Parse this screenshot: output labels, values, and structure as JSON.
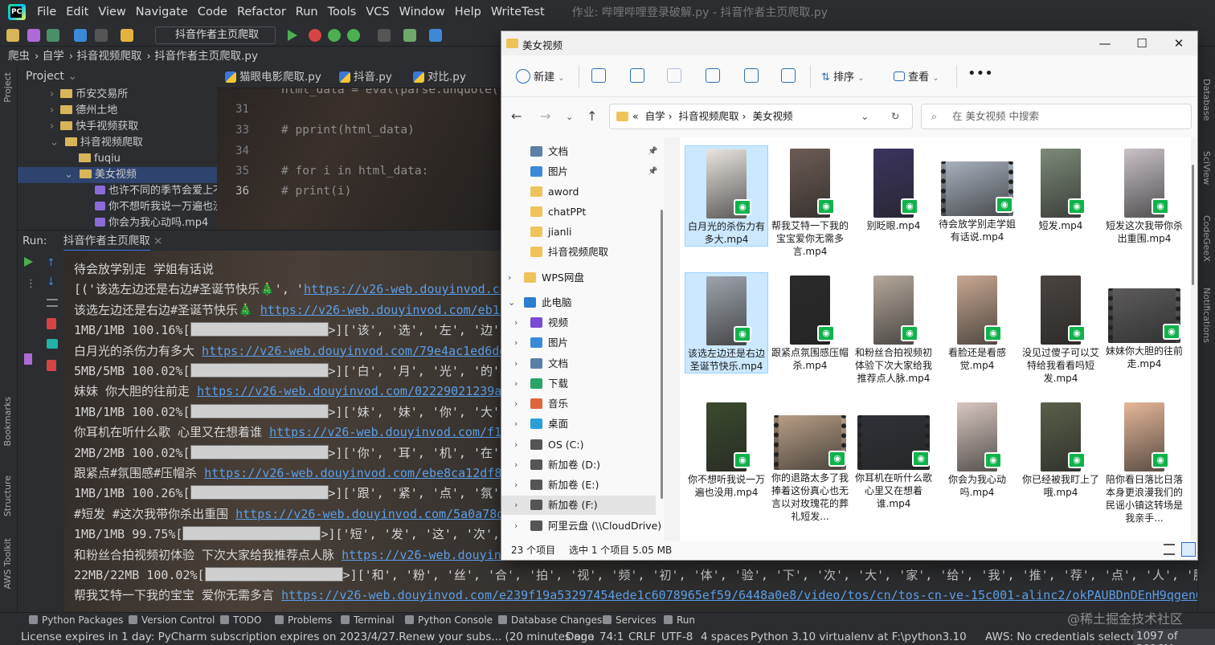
{
  "menu": {
    "items": [
      "File",
      "Edit",
      "View",
      "Navigate",
      "Code",
      "Refactor",
      "Run",
      "Tools",
      "VCS",
      "Window",
      "Help",
      "WriteTest"
    ],
    "title": "作业: 哔哩哔哩登录破解.py - 抖音作者主页爬取.py"
  },
  "toolbar": {
    "run_config": "抖音作者主页爬取"
  },
  "breadcrumb": [
    "爬虫",
    "自学",
    "抖音视频爬取",
    "抖音作者主页爬取.py"
  ],
  "project": {
    "header": "Project",
    "items": [
      {
        "label": "币安交易所",
        "type": "folder",
        "depth": 1
      },
      {
        "label": "德州土地",
        "type": "folder",
        "depth": 1
      },
      {
        "label": "快手视频获取",
        "type": "folder",
        "depth": 1
      },
      {
        "label": "抖音视频爬取",
        "type": "folder",
        "depth": 1
      },
      {
        "label": "fuqiu",
        "type": "folder",
        "depth": 2
      },
      {
        "label": "美女视频",
        "type": "folder",
        "depth": 2
      },
      {
        "label": "也许不同的季节会爱上不",
        "type": "video",
        "depth": 3
      },
      {
        "label": "你不想听我说一万遍也没",
        "type": "video",
        "depth": 3
      },
      {
        "label": "你会为我心动吗.mp4",
        "type": "video",
        "depth": 3
      }
    ]
  },
  "editor_tabs": [
    "猫眼电影爬取.py",
    "抖音.py",
    "对比.py"
  ],
  "editor": {
    "lines": [
      {
        "num": "31",
        "text": "html_data = eval(parse.unquote("
      },
      {
        "num": "32",
        "text": ""
      },
      {
        "num": "33",
        "text": "# pprint(html_data)"
      },
      {
        "num": "34",
        "text": ""
      },
      {
        "num": "35",
        "text": "# for i in html_data:"
      },
      {
        "num": "36",
        "text": "#     print(i)"
      }
    ]
  },
  "run": {
    "label": "Run:",
    "tab": "抖音作者主页爬取"
  },
  "console": [
    {
      "text": "待会放学别走 学姐有话说",
      "url": "",
      "rest": ""
    },
    {
      "text": "[('该选左边还是右边#圣诞节快乐🎄', '",
      "url": "https://v26-web.douyinvod.com/",
      "rest": ""
    },
    {
      "text": "该选左边还是右边#圣诞节快乐🎄 ",
      "url": "https://v26-web.douyinvod.com/eb131c",
      "rest": ""
    },
    {
      "text": "1MB/1MB 100.16%[",
      "bar": true,
      "rest": ">]['该', '选', '左', '边',"
    },
    {
      "text": "白月光的杀伤力有多大 ",
      "url": "https://v26-web.douyinvod.com/79e4ac1ed6ddc7",
      "rest": ""
    },
    {
      "text": "5MB/5MB 100.02%[",
      "bar": true,
      "rest": ">]['白', '月', '光', '的',"
    },
    {
      "text": "妹妹 你大胆的往前走 ",
      "url": "https://v26-web.douyinvod.com/02229021239a1f4",
      "rest": ""
    },
    {
      "text": "1MB/1MB 100.02%[",
      "bar": true,
      "rest": ">]['妹', '妹', '你', '大',"
    },
    {
      "text": "你耳机在听什么歌 心里又在想着谁 ",
      "url": "https://v26-web.douyinvod.com/f11f7",
      "rest": ""
    },
    {
      "text": "2MB/2MB 100.02%[",
      "bar": true,
      "rest": ">]['你', '耳', '机', '在',"
    },
    {
      "text": "跟紧点#氛围感#压帽杀 ",
      "url": "https://v26-web.douyinvod.com/ebe8ca12df858e",
      "rest": ""
    },
    {
      "text": "1MB/1MB 100.26%[",
      "bar": true,
      "rest": ">]['跟', '紧', '点', '氛',"
    },
    {
      "text": "#短发 #这次我带你杀出重围 ",
      "url": "https://v26-web.douyinvod.com/5a0a78d7d",
      "rest": ""
    },
    {
      "text": "1MB/1MB 99.75%[",
      "bar": true,
      "rest": ">]['短', '发', '这', '次', '我"
    },
    {
      "text": "和粉丝合拍视频初体验 下次大家给我推荐点人脉 ",
      "url": "https://v26-web.douyinvod.com/",
      "rest": ""
    },
    {
      "text": "22MB/22MB 100.02%[",
      "bar": true,
      "rest": ">]['和', '粉', '丝', '合', '拍', '视', '频', '初', '体', '验', '下', '次', '大', '家', '给', '我', '推', '荐', '点', '人', '脉']写入"
    },
    {
      "text": "帮我艾特一下我的宝宝 爱你无需多言 ",
      "url": "https://v26-web.douyinvod.com/e239f19a53297454ede1c6078965ef59/6448a0e8/video/tos/cn/tos-cn-ve-15c001-alinc2/okPAUBDnDEnH9qgenQ1U8W8A",
      "rest": ""
    }
  ],
  "bottom_tabs": [
    "Python Packages",
    "Version Control",
    "TODO",
    "Problems",
    "Terminal",
    "Python Console",
    "Database Changes",
    "Services",
    "Run"
  ],
  "status": {
    "license": "License expires in 1 day: PyCharm subscription expires on 2023/4/27.Renew your subs... (20 minutes ago",
    "done": "Done",
    "pos": "74:1",
    "crlf": "CRLF",
    "enc": "UTF-8",
    "indent": "4 spaces",
    "interp": "Python 3.10 virtualenv at F:\\python3.10",
    "aws": "AWS: No credentials selected",
    "mem": "1097 of 2016M"
  },
  "watermark": "@稀土掘金技术社区",
  "left_strip": [
    "Project",
    "Structure",
    "Bookmarks",
    "AWS Toolkit"
  ],
  "right_strip": [
    "Database",
    "SciView",
    "CodeGeeX",
    "Notifications"
  ],
  "explorer": {
    "title": "美女视频",
    "cmd": {
      "new": "新建",
      "sort": "排序",
      "view": "查看"
    },
    "address": [
      "«",
      "自学",
      "抖音视频爬取",
      "美女视频"
    ],
    "search_placeholder": "在 美女视频 中搜索",
    "nav": [
      {
        "label": "文档",
        "icon": "doc",
        "pin": true
      },
      {
        "label": "图片",
        "icon": "pic",
        "pin": true
      },
      {
        "label": "aword",
        "icon": "folder"
      },
      {
        "label": "chatPPt",
        "icon": "folder"
      },
      {
        "label": "jianli",
        "icon": "folder"
      },
      {
        "label": "抖音视频爬取",
        "icon": "folder"
      },
      {
        "label": "WPS网盘",
        "icon": "folder",
        "chev": "›"
      },
      {
        "label": "此电脑",
        "icon": "pc",
        "chev": "⌄"
      },
      {
        "label": "视频",
        "icon": "video",
        "chev": "›"
      },
      {
        "label": "图片",
        "icon": "pic",
        "chev": "›"
      },
      {
        "label": "文档",
        "icon": "doc",
        "chev": "›"
      },
      {
        "label": "下载",
        "icon": "down",
        "chev": "›"
      },
      {
        "label": "音乐",
        "icon": "music",
        "chev": "›"
      },
      {
        "label": "桌面",
        "icon": "desk",
        "chev": "›"
      },
      {
        "label": "OS (C:)",
        "icon": "drive",
        "chev": "›"
      },
      {
        "label": "新加卷 (D:)",
        "icon": "drive",
        "chev": "›"
      },
      {
        "label": "新加卷 (E:)",
        "icon": "drive",
        "chev": "›"
      },
      {
        "label": "新加卷 (F:)",
        "icon": "drive",
        "chev": "›",
        "selected": true
      },
      {
        "label": "阿里云盘 (\\\\CloudDrive) (C",
        "icon": "drive",
        "chev": "›"
      }
    ],
    "files": [
      {
        "name": "白月光的杀伤力有多大.mp4",
        "sel": true,
        "color": "#e9e4df"
      },
      {
        "name": "帮我艾特一下我的宝宝爱你无需多言.mp4",
        "color": "#6d5c55"
      },
      {
        "name": "别眨眼.mp4",
        "color": "#3c3460"
      },
      {
        "name": "待会放学别走学姐有话说.mp4",
        "wide": true,
        "color": "#a7b0bd"
      },
      {
        "name": "短发.mp4",
        "color": "#7d8a78"
      },
      {
        "name": "短发这次我带你杀出重围.mp4",
        "color": "#c9c2c8"
      },
      {
        "name": "该选左边还是右边圣诞节快乐.mp4",
        "sel": true,
        "color": "#9ea4ad"
      },
      {
        "name": "跟紧点氛围感压帽杀.mp4",
        "color": "#2a2a2a"
      },
      {
        "name": "和粉丝合拍视频初体验下次大家给我推荐点人脉.mp4",
        "color": "#b4a79a"
      },
      {
        "name": "看脸还是看感觉.mp4",
        "color": "#c7a791"
      },
      {
        "name": "没见过傻子可以艾特给我看看吗短发.mp4",
        "color": "#4a4440"
      },
      {
        "name": "妹妹你大胆的往前走.mp4",
        "wide": true,
        "color": "#5d5b5c"
      },
      {
        "name": "你不想听我说一万遍也没用.mp4",
        "color": "#3b4a2e"
      },
      {
        "name": "你的退路太多了我捧着这份真心也无言以对玫瑰花的葬礼短发...",
        "wide": true,
        "color": "#b79d85"
      },
      {
        "name": "你耳机在听什么歌心里又在想着谁.mp4",
        "wide": true,
        "color": "#2e3238"
      },
      {
        "name": "你会为我心动吗.mp4",
        "color": "#d8c7bf"
      },
      {
        "name": "你已经被我盯上了哦.mp4",
        "color": "#59604a"
      },
      {
        "name": "陪你看日落比日落本身更浪漫我们的民谣小镇这转场是我亲手...",
        "color": "#e5b79a"
      }
    ],
    "status": {
      "count": "23 个项目",
      "selected": "选中 1 个项目  5.05 MB"
    }
  }
}
